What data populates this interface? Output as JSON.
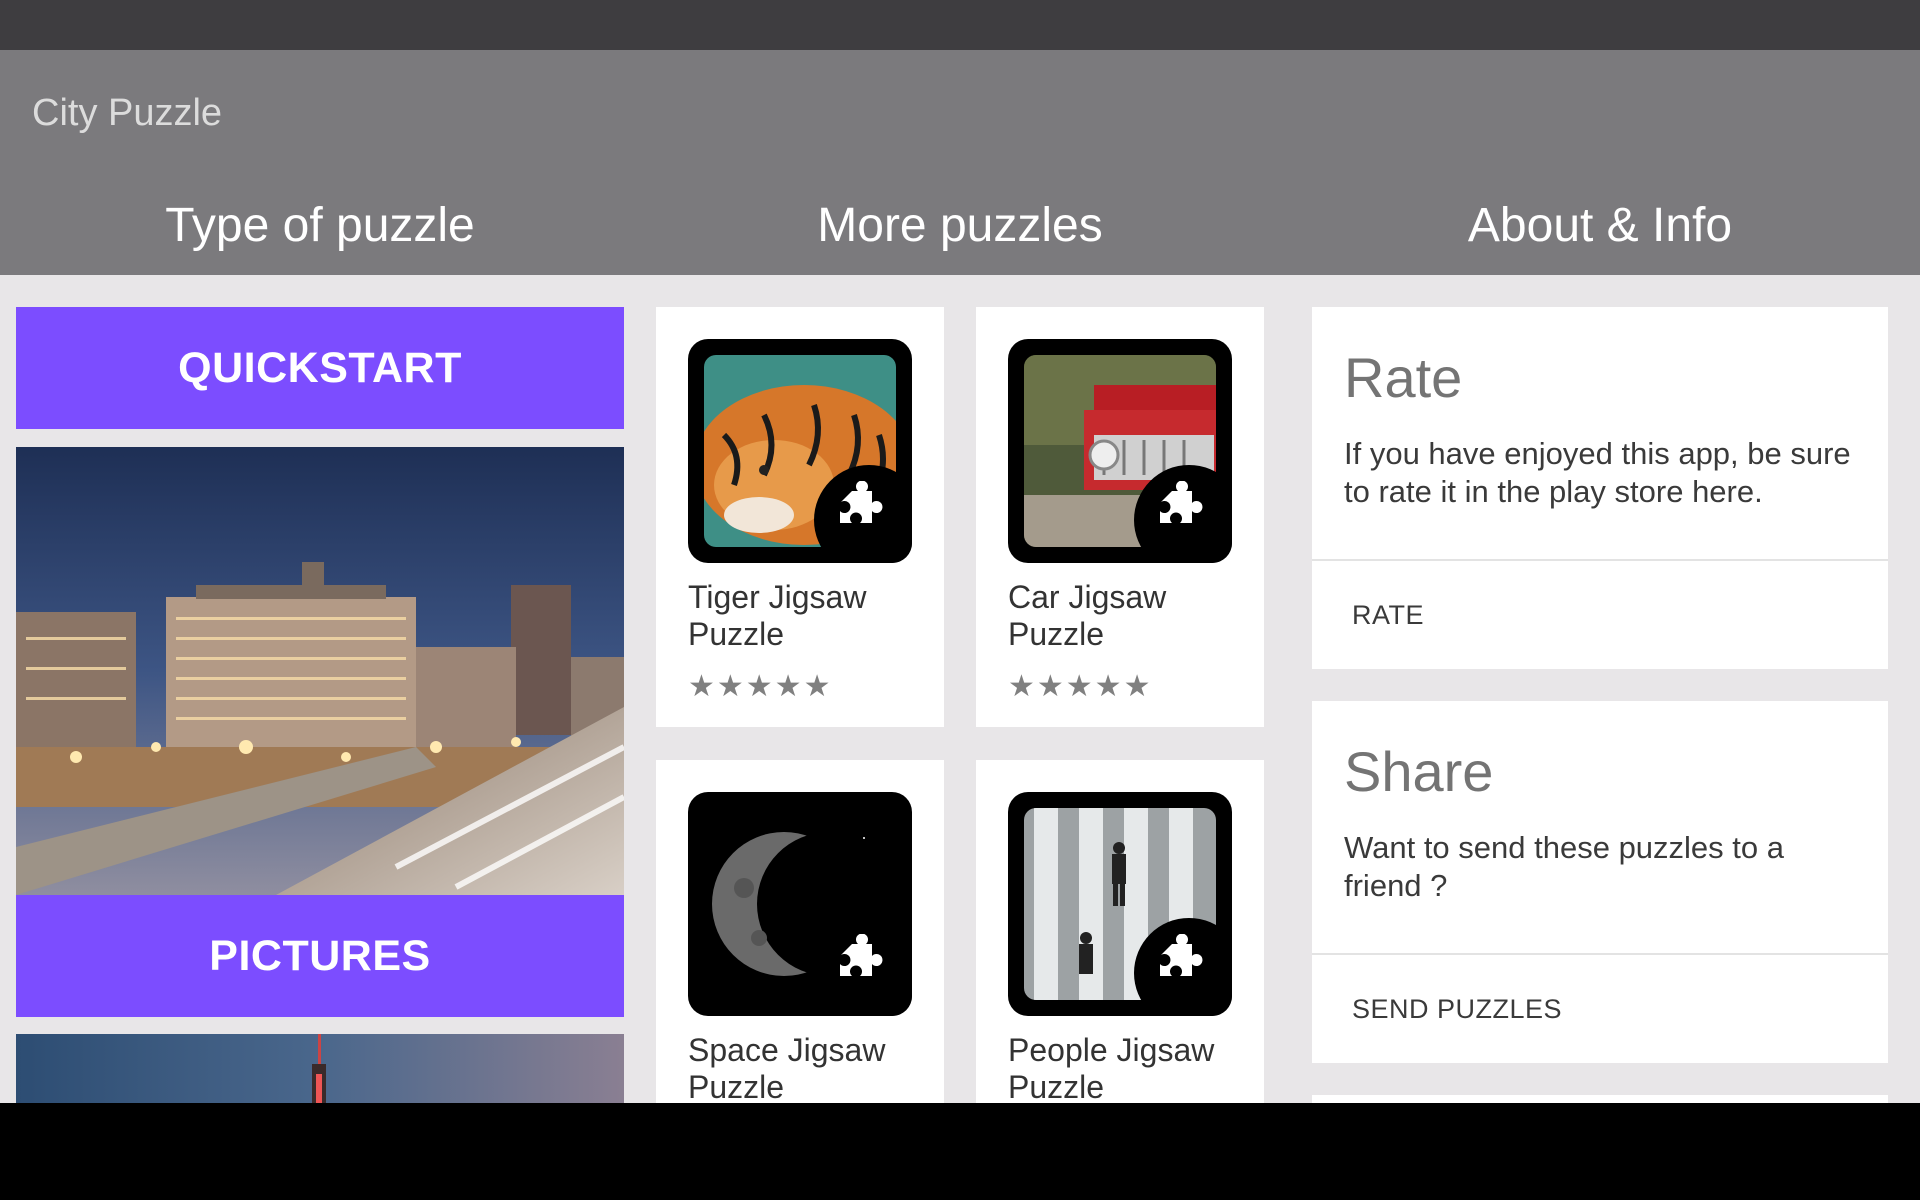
{
  "app": {
    "title": "City Puzzle"
  },
  "tabs": [
    {
      "label": "Type of puzzle"
    },
    {
      "label": "More puzzles"
    },
    {
      "label": "About & Info"
    }
  ],
  "type_of_puzzle": {
    "quickstart_label": "QUICKSTART",
    "pictures_label": "PICTURES"
  },
  "more_puzzles": [
    {
      "name": "Tiger Jigsaw Puzzle",
      "rating": 5
    },
    {
      "name": "Car Jigsaw Puzzle",
      "rating": 5
    },
    {
      "name": "Space Jigsaw Puzzle"
    },
    {
      "name": "People Jigsaw Puzzle"
    }
  ],
  "about": {
    "rate": {
      "title": "Rate",
      "text": "If you have enjoyed this app, be sure to rate it in the play store here.",
      "action": "RATE"
    },
    "share": {
      "title": "Share",
      "text": "Want to send these puzzles to a friend ?",
      "action": "SEND PUZZLES"
    }
  },
  "icons": {
    "stars": "★★★★★",
    "puzzle_badge": "puzzle-piece-icon"
  },
  "colors": {
    "accent": "#7c4dff",
    "app_bar": "#7b7a7d",
    "status_bar": "#3e3d40"
  }
}
